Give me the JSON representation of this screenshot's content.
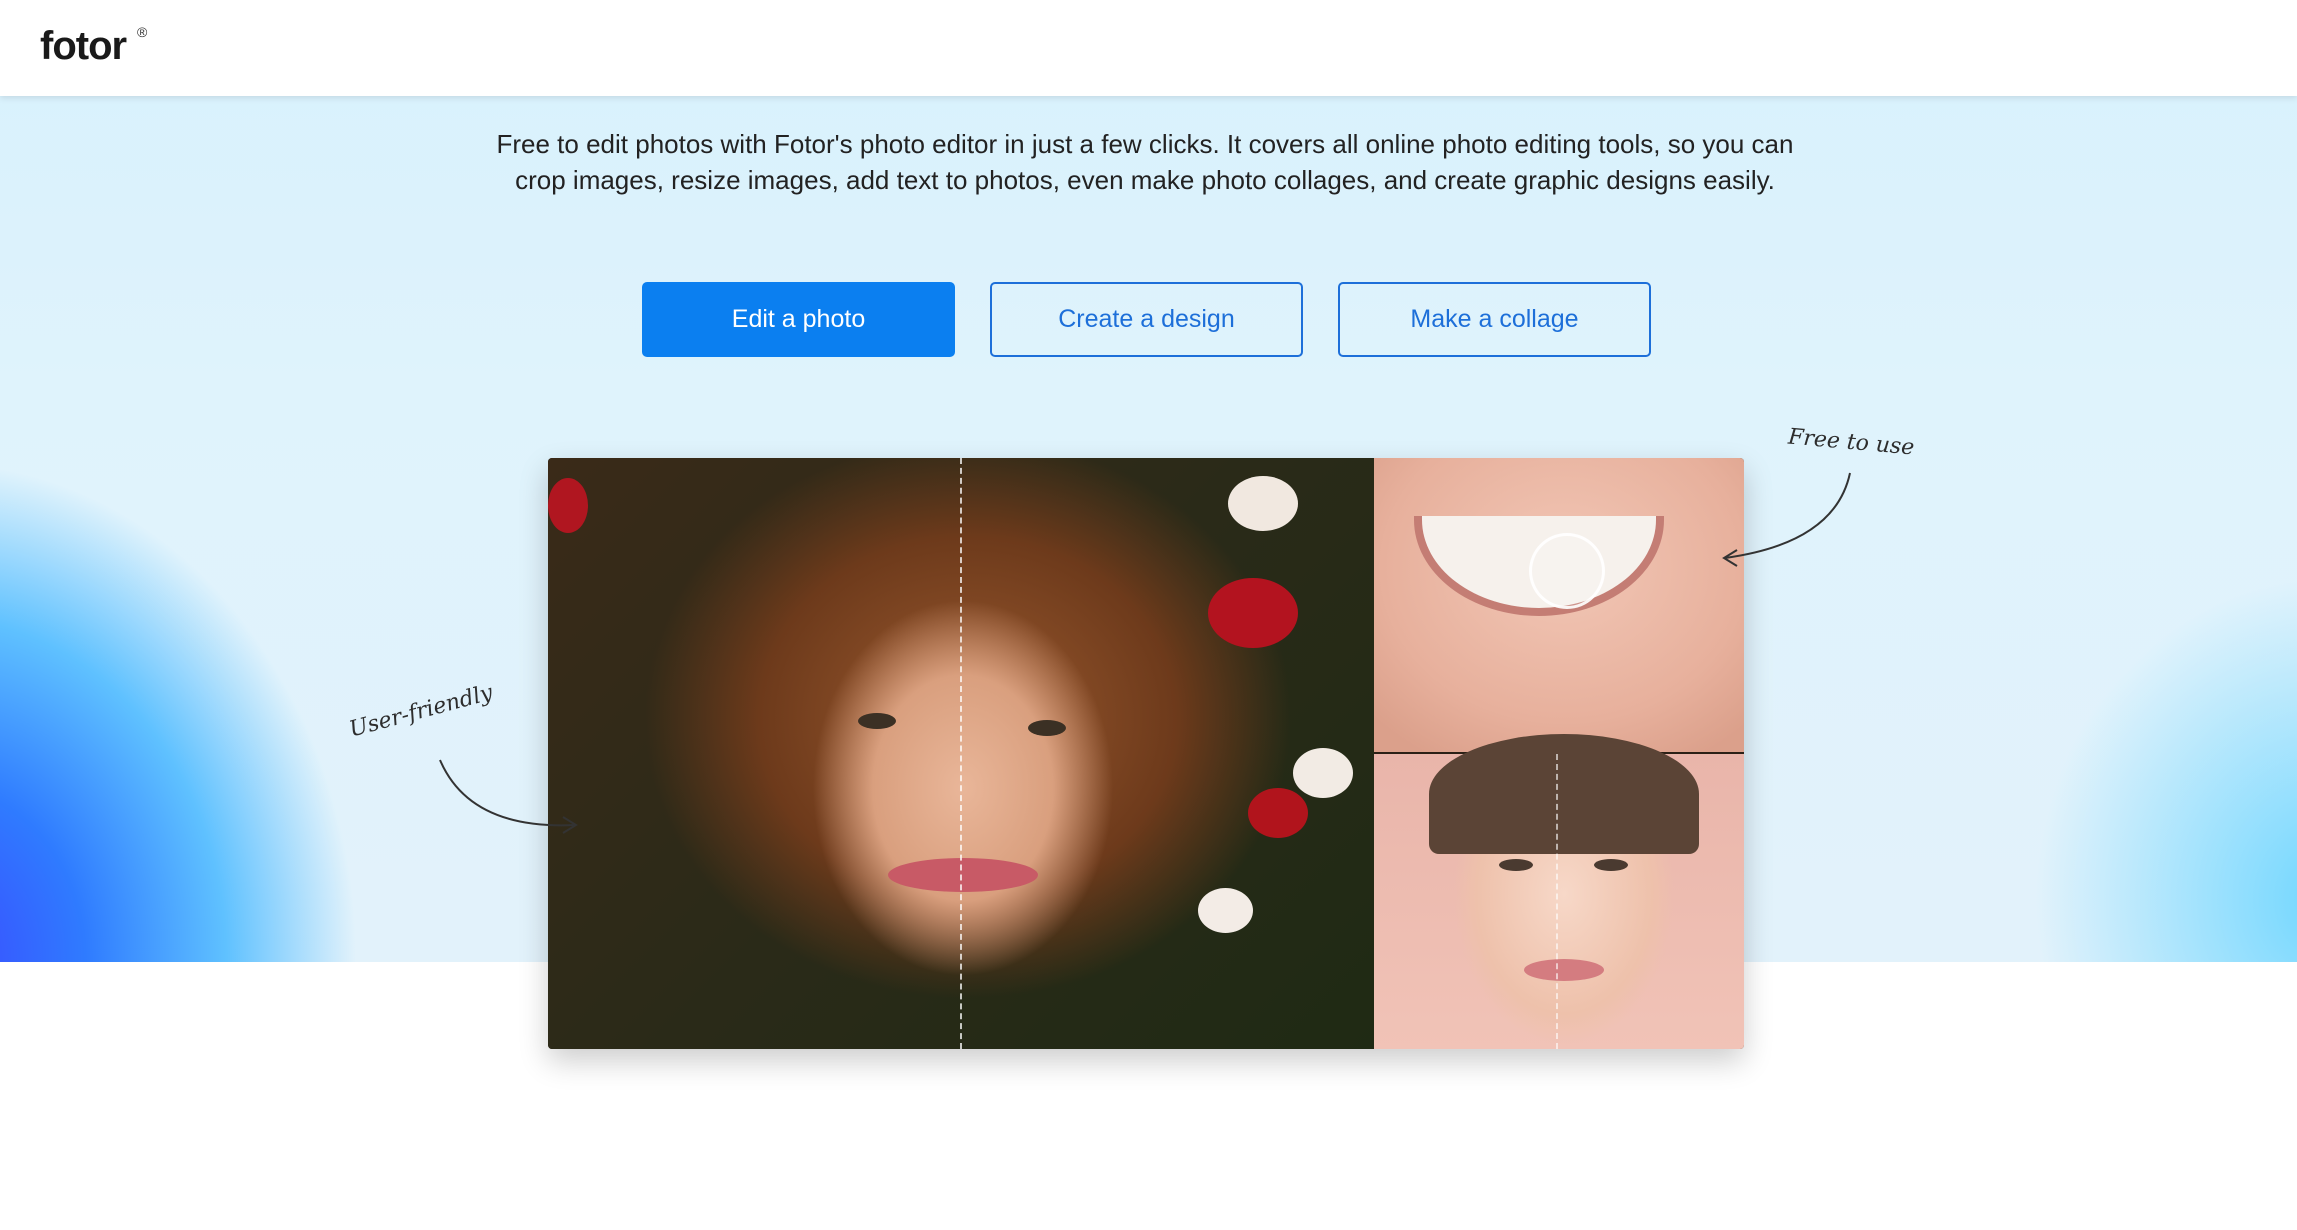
{
  "header": {
    "logo_text": "fotor",
    "logo_mark": "®"
  },
  "hero": {
    "description": "Free to edit photos with Fotor's photo editor in just a few clicks. It covers all online photo editing tools, so you can crop images, resize images, add text to photos, even make photo collages, and create graphic designs easily.",
    "buttons": {
      "edit_photo": "Edit a photo",
      "create_design": "Create a design",
      "make_collage": "Make a collage"
    },
    "annotations": {
      "left": "User-friendly",
      "right": "Free to use"
    }
  },
  "colors": {
    "primary": "#0b7ff0",
    "outline": "#1d6fd9"
  },
  "icons": {
    "left_arrow": "curved-arrow-icon",
    "right_arrow": "curved-arrow-icon"
  }
}
